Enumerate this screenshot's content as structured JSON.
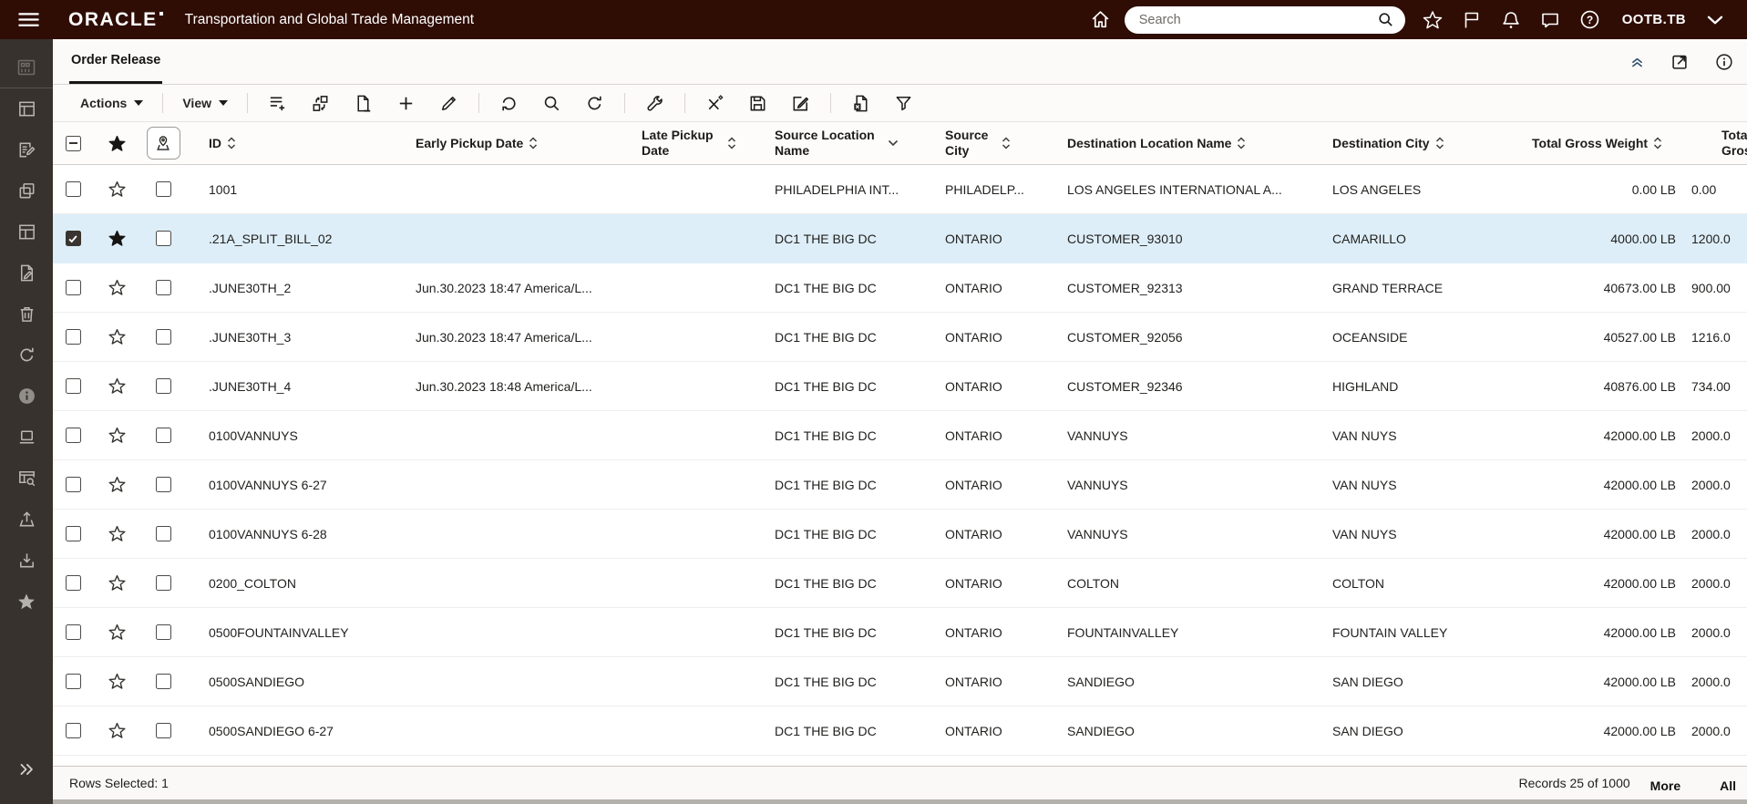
{
  "topbar": {
    "logo_text": "ORACLE",
    "product_title": "Transportation and Global Trade Management",
    "search_placeholder": "Search",
    "user_badge": "OOTB.TB",
    "icons": [
      "menu-icon",
      "home-icon",
      "search-icon",
      "favorites-icon",
      "flag-icon",
      "notifications-icon",
      "messages-icon",
      "help-icon",
      "user-menu-chevron-icon"
    ]
  },
  "sidebar": {
    "icons": [
      "dashboard-icon",
      "table-layout-icon",
      "list-edit-icon",
      "copy-icon",
      "panel-layout-icon",
      "file-edit-icon",
      "delete-icon",
      "refresh-icon",
      "info-icon",
      "laptop-icon",
      "table-search-icon",
      "upload-icon",
      "download-icon",
      "favorites-star-icon",
      "expand-icon"
    ]
  },
  "tabbar": {
    "active_tab": "Order Release",
    "icons": [
      "collapse-icon",
      "open-in-new-window-icon",
      "page-info-icon"
    ]
  },
  "toolbar": {
    "actions_label": "Actions",
    "view_label": "View",
    "icons": [
      "add-to-list-icon",
      "reorder-icon",
      "remove-page-icon",
      "add-icon",
      "edit-icon",
      "refresh-ccw-icon",
      "search-icon",
      "refresh-cw-icon",
      "tools-icon",
      "unassign-icon",
      "save-icon",
      "edit-note-icon",
      "export-excel-icon",
      "filter-icon"
    ]
  },
  "table": {
    "columns": [
      {
        "label": "ID",
        "sort": "both"
      },
      {
        "label": "Early Pickup Date",
        "sort": "both"
      },
      {
        "label": "Late Pickup Date",
        "sort": "both"
      },
      {
        "label": "Source Location Name",
        "sort": "down"
      },
      {
        "label": "Source City",
        "sort": "both"
      },
      {
        "label": "Destination Location Name",
        "sort": "both"
      },
      {
        "label": "Destination City",
        "sort": "both"
      },
      {
        "label": "Total Gross Weight",
        "sort": "both"
      },
      {
        "label": "Total Gross",
        "sort": "none"
      }
    ],
    "rows": [
      {
        "id": "1001",
        "early": "",
        "late": "",
        "src_loc": "PHILADELPHIA INT...",
        "src_city": "PHILADELP...",
        "dest_loc": "LOS ANGELES INTERNATIONAL A...",
        "dest_city": "LOS ANGELES",
        "weight": "0.00 LB",
        "vol": "0.00",
        "selected": false,
        "starred": false
      },
      {
        "id": ".21A_SPLIT_BILL_02",
        "early": "",
        "late": "",
        "src_loc": "DC1 THE BIG DC",
        "src_city": "ONTARIO",
        "dest_loc": "CUSTOMER_93010",
        "dest_city": "CAMARILLO",
        "weight": "4000.00 LB",
        "vol": "1200.0",
        "selected": true,
        "starred": true
      },
      {
        "id": ".JUNE30TH_2",
        "early": "Jun.30.2023 18:47 America/L...",
        "late": "",
        "src_loc": "DC1 THE BIG DC",
        "src_city": "ONTARIO",
        "dest_loc": "CUSTOMER_92313",
        "dest_city": "GRAND TERRACE",
        "weight": "40673.00 LB",
        "vol": "900.00",
        "selected": false,
        "starred": false
      },
      {
        "id": ".JUNE30TH_3",
        "early": "Jun.30.2023 18:47 America/L...",
        "late": "",
        "src_loc": "DC1 THE BIG DC",
        "src_city": "ONTARIO",
        "dest_loc": "CUSTOMER_92056",
        "dest_city": "OCEANSIDE",
        "weight": "40527.00 LB",
        "vol": "1216.0",
        "selected": false,
        "starred": false
      },
      {
        "id": ".JUNE30TH_4",
        "early": "Jun.30.2023 18:48 America/L...",
        "late": "",
        "src_loc": "DC1 THE BIG DC",
        "src_city": "ONTARIO",
        "dest_loc": "CUSTOMER_92346",
        "dest_city": "HIGHLAND",
        "weight": "40876.00 LB",
        "vol": "734.00",
        "selected": false,
        "starred": false
      },
      {
        "id": "0100VANNUYS",
        "early": "",
        "late": "",
        "src_loc": "DC1 THE BIG DC",
        "src_city": "ONTARIO",
        "dest_loc": "VANNUYS",
        "dest_city": "VAN NUYS",
        "weight": "42000.00 LB",
        "vol": "2000.0",
        "selected": false,
        "starred": false
      },
      {
        "id": "0100VANNUYS 6-27",
        "early": "",
        "late": "",
        "src_loc": "DC1 THE BIG DC",
        "src_city": "ONTARIO",
        "dest_loc": "VANNUYS",
        "dest_city": "VAN NUYS",
        "weight": "42000.00 LB",
        "vol": "2000.0",
        "selected": false,
        "starred": false
      },
      {
        "id": "0100VANNUYS 6-28",
        "early": "",
        "late": "",
        "src_loc": "DC1 THE BIG DC",
        "src_city": "ONTARIO",
        "dest_loc": "VANNUYS",
        "dest_city": "VAN NUYS",
        "weight": "42000.00 LB",
        "vol": "2000.0",
        "selected": false,
        "starred": false
      },
      {
        "id": "0200_COLTON",
        "early": "",
        "late": "",
        "src_loc": "DC1 THE BIG DC",
        "src_city": "ONTARIO",
        "dest_loc": "COLTON",
        "dest_city": "COLTON",
        "weight": "42000.00 LB",
        "vol": "2000.0",
        "selected": false,
        "starred": false
      },
      {
        "id": "0500FOUNTAINVALLEY",
        "early": "",
        "late": "",
        "src_loc": "DC1 THE BIG DC",
        "src_city": "ONTARIO",
        "dest_loc": "FOUNTAINVALLEY",
        "dest_city": "FOUNTAIN VALLEY",
        "weight": "42000.00 LB",
        "vol": "2000.0",
        "selected": false,
        "starred": false
      },
      {
        "id": "0500SANDIEGO",
        "early": "",
        "late": "",
        "src_loc": "DC1 THE BIG DC",
        "src_city": "ONTARIO",
        "dest_loc": "SANDIEGO",
        "dest_city": "SAN DIEGO",
        "weight": "42000.00 LB",
        "vol": "2000.0",
        "selected": false,
        "starred": false
      },
      {
        "id": "0500SANDIEGO 6-27",
        "early": "",
        "late": "",
        "src_loc": "DC1 THE BIG DC",
        "src_city": "ONTARIO",
        "dest_loc": "SANDIEGO",
        "dest_city": "SAN DIEGO",
        "weight": "42000.00 LB",
        "vol": "2000.0",
        "selected": false,
        "starred": false
      }
    ]
  },
  "footer": {
    "rows_selected": "Rows Selected: 1",
    "records": "Records 25 of 1000",
    "more_label": "More",
    "all_label": "All"
  }
}
